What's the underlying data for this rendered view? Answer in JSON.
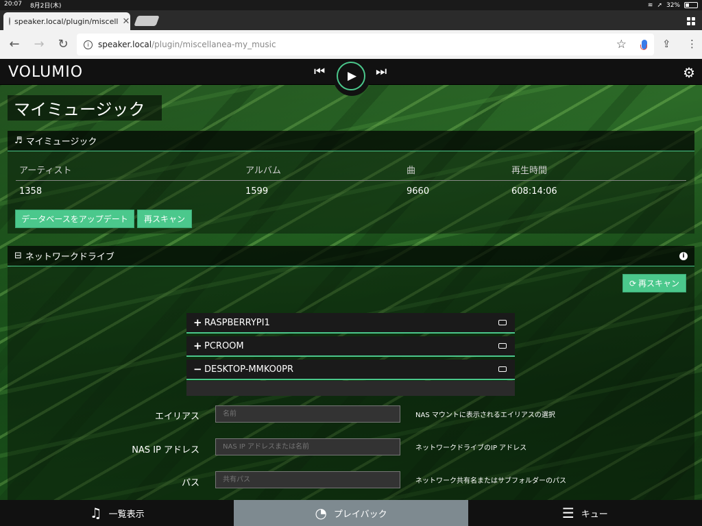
{
  "status": {
    "time": "20:07",
    "date": "8月2日(木)",
    "battery": "32%"
  },
  "browser": {
    "tab_title": "speaker.local/plugin/miscell",
    "url_host": "speaker.local",
    "url_path": "/plugin/miscellanea-my_music"
  },
  "app": {
    "logo": "VOLUMIO",
    "page_title": "マイミュージック"
  },
  "my_music": {
    "header": "マイミュージック",
    "columns": [
      "アーティスト",
      "アルバム",
      "曲",
      "再生時間"
    ],
    "values": [
      "1358",
      "1599",
      "9660",
      "608:14:06"
    ],
    "update_db_label": "データベースをアップデート",
    "rescan_label": "再スキャン"
  },
  "network": {
    "header": "ネットワークドライブ",
    "rescan_label": "再スキャン",
    "drives": [
      {
        "sign": "+",
        "name": "RASPBERRYPI1"
      },
      {
        "sign": "+",
        "name": "PCROOM"
      },
      {
        "sign": "−",
        "name": "DESKTOP-MMKO0PR"
      }
    ],
    "fields": [
      {
        "label": "エイリアス",
        "placeholder": "名前",
        "help": "NAS マウントに表示されるエイリアスの選択"
      },
      {
        "label": "NAS IP アドレス",
        "placeholder": "NAS IP アドレスまたは名前",
        "help": "ネットワークドライブのIP アドレス"
      },
      {
        "label": "パス",
        "placeholder": "共有パス",
        "help": "ネットワーク共有名またはサブフォルダーのパス"
      }
    ]
  },
  "footer": {
    "browse": "一覧表示",
    "playback": "プレイバック",
    "queue": "キュー"
  },
  "colors": {
    "accent": "#4bc88c"
  }
}
